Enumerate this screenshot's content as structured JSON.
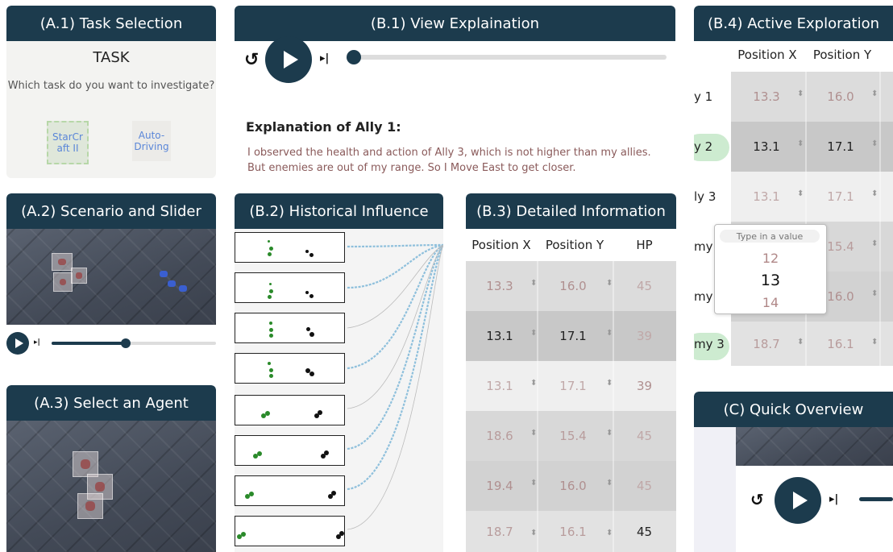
{
  "a1": {
    "title": "(A.1) Task Selection",
    "heading": "TASK",
    "question": "Which task do you want to investigate?",
    "options": [
      "StarCr aft II",
      "Auto- Driving"
    ]
  },
  "a2": {
    "title": "(A.2) Scenario and  Slider",
    "skip": "▸|"
  },
  "a3": {
    "title": "(A.3) Select an Agent"
  },
  "b1": {
    "title": "(B.1) View Explaination",
    "skip": "▸|",
    "expl_title": "Explanation of Ally 1:",
    "expl_text_1": "I observed the health and action of Ally 3, which is not higher than my allies.",
    "expl_text_2": "But enemies are out of my range. So I Move East to get closer."
  },
  "b2": {
    "title": "(B.2) Historical Influence"
  },
  "b3": {
    "title": "(B.3) Detailed Information",
    "headers": [
      "Position X",
      "Position Y",
      "HP"
    ],
    "rows": [
      {
        "x": "13.3",
        "y": "16.0",
        "hp": "45"
      },
      {
        "x": "13.1",
        "y": "17.1",
        "hp": "39"
      },
      {
        "x": "13.1",
        "y": "17.1",
        "hp": "39"
      },
      {
        "x": "18.6",
        "y": "15.4",
        "hp": "45"
      },
      {
        "x": "19.4",
        "y": "16.0",
        "hp": "45"
      },
      {
        "x": "18.7",
        "y": "16.1",
        "hp": "45"
      }
    ]
  },
  "b4": {
    "title": "(B.4) Active Exploration",
    "headers": [
      "Position X",
      "Position Y"
    ],
    "rows": [
      {
        "agent": "y 1",
        "x": "13.3",
        "y": "16.0"
      },
      {
        "agent": "y 2",
        "x": "13.1",
        "y": "17.1"
      },
      {
        "agent": "ly 3",
        "x": "13.1",
        "y": "17.1"
      },
      {
        "agent": "my",
        "x": "",
        "y": "15.4"
      },
      {
        "agent": "my",
        "x": "",
        "y": "16.0"
      },
      {
        "agent": "my 3",
        "x": "18.7",
        "y": "16.1"
      }
    ],
    "picker": {
      "placeholder": "Type in a value",
      "options": [
        "12",
        "13",
        "14"
      ]
    }
  },
  "c": {
    "title": "(C) Quick Overview",
    "skip": "▸|"
  },
  "colors": {
    "header": "#1c3b4d",
    "highlight": "#cdebd0",
    "curve": "#8fc0dc"
  }
}
